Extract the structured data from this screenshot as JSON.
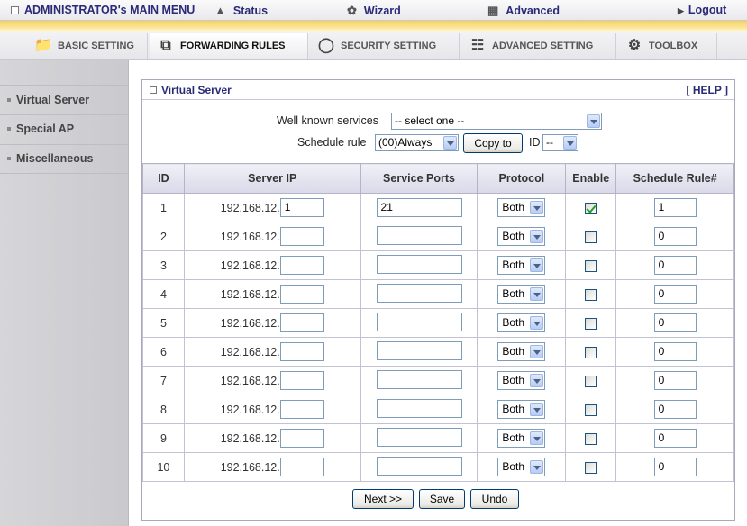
{
  "topmenu": {
    "admin": "ADMINISTRATOR's MAIN MENU",
    "status": "Status",
    "wizard": "Wizard",
    "advanced": "Advanced",
    "logout": "Logout"
  },
  "tabs": {
    "basic": "BASIC SETTING",
    "forwarding": "FORWARDING RULES",
    "security": "SECURITY SETTING",
    "advanced": "ADVANCED SETTING",
    "toolbox": "TOOLBOX"
  },
  "sidebar": {
    "items": [
      "Virtual Server",
      "Special AP",
      "Miscellaneous"
    ]
  },
  "panel": {
    "title": "Virtual Server",
    "help": "[ HELP ]",
    "well_known_label": "Well known services",
    "well_known_value": "-- select one --",
    "schedule_label": "Schedule rule",
    "schedule_value": "(00)Always",
    "copy_to": "Copy to",
    "id_label": "ID",
    "id_value": "--"
  },
  "table": {
    "headers": [
      "ID",
      "Server IP",
      "Service Ports",
      "Protocol",
      "Enable",
      "Schedule Rule#"
    ],
    "ip_prefix": "192.168.12.",
    "rows": [
      {
        "id": "1",
        "ip": "1",
        "ports": "21",
        "protocol": "Both",
        "enabled": true,
        "schedule": "1"
      },
      {
        "id": "2",
        "ip": "",
        "ports": "",
        "protocol": "Both",
        "enabled": false,
        "schedule": "0"
      },
      {
        "id": "3",
        "ip": "",
        "ports": "",
        "protocol": "Both",
        "enabled": false,
        "schedule": "0"
      },
      {
        "id": "4",
        "ip": "",
        "ports": "",
        "protocol": "Both",
        "enabled": false,
        "schedule": "0"
      },
      {
        "id": "5",
        "ip": "",
        "ports": "",
        "protocol": "Both",
        "enabled": false,
        "schedule": "0"
      },
      {
        "id": "6",
        "ip": "",
        "ports": "",
        "protocol": "Both",
        "enabled": false,
        "schedule": "0"
      },
      {
        "id": "7",
        "ip": "",
        "ports": "",
        "protocol": "Both",
        "enabled": false,
        "schedule": "0"
      },
      {
        "id": "8",
        "ip": "",
        "ports": "",
        "protocol": "Both",
        "enabled": false,
        "schedule": "0"
      },
      {
        "id": "9",
        "ip": "",
        "ports": "",
        "protocol": "Both",
        "enabled": false,
        "schedule": "0"
      },
      {
        "id": "10",
        "ip": "",
        "ports": "",
        "protocol": "Both",
        "enabled": false,
        "schedule": "0"
      }
    ]
  },
  "buttons": {
    "next": "Next >>",
    "save": "Save",
    "undo": "Undo"
  },
  "icons": {
    "status": "status-icon",
    "wizard": "wizard-icon",
    "advanced": "advanced-icon",
    "logout": "arrow-right-icon"
  },
  "colors": {
    "accent": "#2a2a78",
    "band": "#f5d35a",
    "check": "#21a121"
  }
}
